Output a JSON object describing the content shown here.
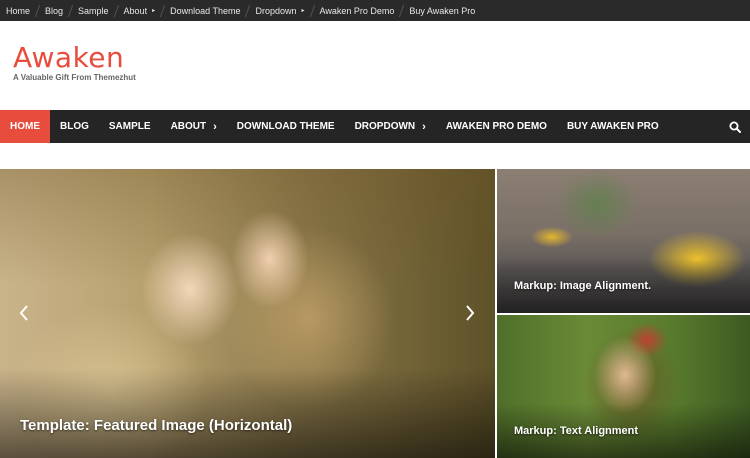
{
  "topbar": {
    "items": [
      {
        "label": "Home"
      },
      {
        "label": "Blog"
      },
      {
        "label": "Sample"
      },
      {
        "label": "About"
      },
      {
        "label": "Download Theme"
      },
      {
        "label": "Dropdown"
      },
      {
        "label": "Awaken Pro Demo"
      },
      {
        "label": "Buy Awaken Pro"
      }
    ],
    "caret_glyph": "▸"
  },
  "header": {
    "logo": "Awaken",
    "tagline": "A Valuable Gift From Themezhut"
  },
  "nav": {
    "items": [
      {
        "label": "HOME"
      },
      {
        "label": "BLOG"
      },
      {
        "label": "SAMPLE"
      },
      {
        "label": "ABOUT"
      },
      {
        "label": "DOWNLOAD THEME"
      },
      {
        "label": "DROPDOWN"
      },
      {
        "label": "AWAKEN PRO DEMO"
      },
      {
        "label": "BUY AWAKEN PRO"
      }
    ],
    "chevron_glyph": "›",
    "accent_color": "#e74c3c",
    "bar_color": "#252525"
  },
  "slider": {
    "main_title": "Template: Featured Image (Horizontal)",
    "side": [
      {
        "title": "Markup: Image Alignment."
      },
      {
        "title": "Markup: Text Alignment"
      }
    ]
  },
  "icons": {
    "search": "search-icon",
    "prev": "chevron-left-icon",
    "next": "chevron-right-icon"
  }
}
